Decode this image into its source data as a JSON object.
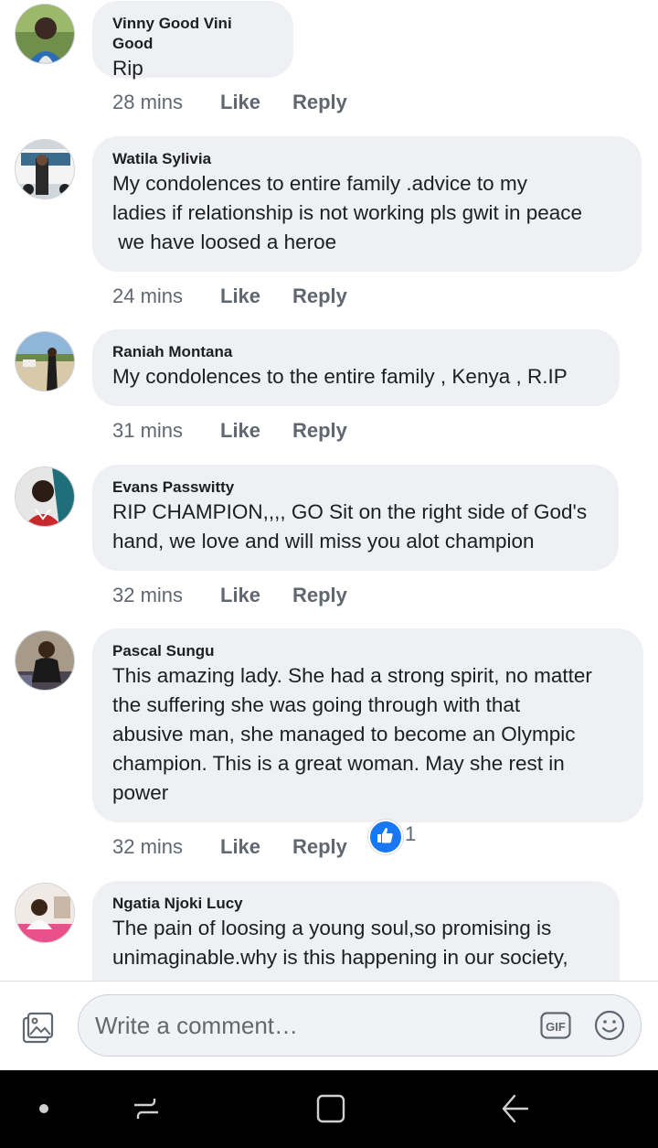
{
  "comments": [
    {
      "name": "Vinny Good Vini Good",
      "text": "Rip",
      "time": "28 mins",
      "like": "Like",
      "reply": "Reply"
    },
    {
      "name": "Watila Sylivia",
      "text": "My condolences to entire family .advice to my\nladies if relationship is not working pls gwit in peace\n we have loosed a heroe",
      "time": "24 mins",
      "like": "Like",
      "reply": "Reply"
    },
    {
      "name": "Raniah Montana",
      "text": "My condolences to the entire family , Kenya , R.IP",
      "time": "31 mins",
      "like": "Like",
      "reply": "Reply"
    },
    {
      "name": "Evans Passwitty",
      "text": "RIP CHAMPION,,,, GO Sit on the right side of God's\nhand, we love and will miss you alot champion",
      "time": "32 mins",
      "like": "Like",
      "reply": "Reply"
    },
    {
      "name": "Pascal Sungu",
      "text": "This amazing lady. She had a strong spirit, no matter\nthe suffering she was going through with that\nabusive man, she managed to become an Olympic\nchampion. This is a great woman. May she rest in\npower",
      "time": "32 mins",
      "like": "Like",
      "reply": "Reply",
      "reaction_count": "1",
      "reaction_icon": "thumbs-up-icon"
    },
    {
      "name": "Ngatia Njoki Lucy",
      "text": "The pain of loosing a young soul,so promising is\nunimaginable.why is this happening in our society,"
    }
  ],
  "composer": {
    "placeholder": "Write a comment…",
    "icons": [
      "photo-icon",
      "gif-icon",
      "emoji-icon"
    ]
  },
  "navbar": {
    "icons": [
      "home-dot-icon",
      "recents-icon",
      "overview-icon",
      "back-icon"
    ]
  },
  "colors": {
    "bubble": "#eff0f3",
    "meta_text": "#606770",
    "like_reaction": "#1877f2",
    "navbar": "#000000"
  }
}
